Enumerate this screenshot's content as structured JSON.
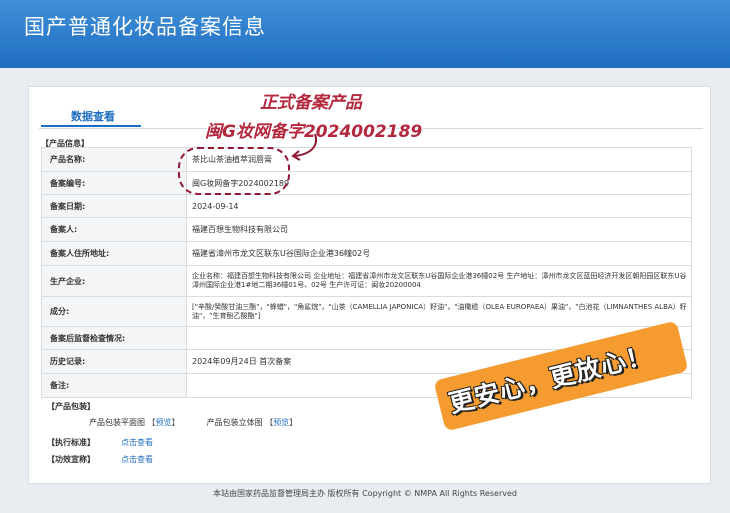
{
  "header": {
    "title": "国产普通化妆品备案信息"
  },
  "tab": {
    "label": "数据查看"
  },
  "section_product_info": "【产品信息】",
  "rows": [
    {
      "key": "产品名称:",
      "value": "茶比山茶油植萃润唇膏"
    },
    {
      "key": "备案编号:",
      "value": "闽G妆网备字2024002189"
    },
    {
      "key": "备案日期:",
      "value": "2024-09-14"
    },
    {
      "key": "备案人:",
      "value": "福建百想生物科技有限公司"
    },
    {
      "key": "备案人住所地址:",
      "value": "福建省漳州市龙文区联东U谷国际企业港36幢02号"
    },
    {
      "key": "生产企业:",
      "value": "企业名称：福建百想生物科技有限公司 企业地址：福建省漳州市龙文区联东U谷国际企业港36幢02号 生产地址：漳州市龙文区蓝田经济开发区朝阳园区联东U谷漳州国际企业港1#地二期36幢01号、02号 生产许可证：闽妆20200004"
    },
    {
      "key": "成分:",
      "value": "[\"辛酸/癸酸甘油三酯\"，\"蜂蜡\"，\"角鲨烷\"，\"山茶（CAMELLIA JAPONICA）籽油\"，\"油橄榄（OLEA EUROPAEA）果油\"，\"白池花（LIMNANTHES ALBA）籽油\"，\"生育酚乙酸酯\"]"
    },
    {
      "key": "备案后监督检查情况:",
      "value": ""
    },
    {
      "key": "历史记录:",
      "value": "2024年09月24日 首次备案"
    },
    {
      "key": "备注:",
      "value": ""
    }
  ],
  "section_package": "【产品包装】",
  "package": {
    "flat_label": "产品包装平面图",
    "flat_link": "预览",
    "solid_label": "产品包装立体图",
    "solid_link": "预览",
    "bracket_open": "【",
    "bracket_close": "】"
  },
  "exec_standard": {
    "label": "【执行标准】",
    "link": "点击查看"
  },
  "efficacy": {
    "label": "【功效宣称】",
    "link": "点击查看"
  },
  "footer": "本站由国家药品监督管理局主办 版权所有 Copyright © NMPA All Rights Reserved",
  "overlay": {
    "line1": "正式备案产品",
    "line2": "闽G妆网备字2024002189",
    "stamp": "更安心，更放心！"
  },
  "colors": {
    "brand_blue": "#1f6ec2",
    "annotation_red": "#b4283e",
    "stamp_orange": "#f59b2f"
  }
}
